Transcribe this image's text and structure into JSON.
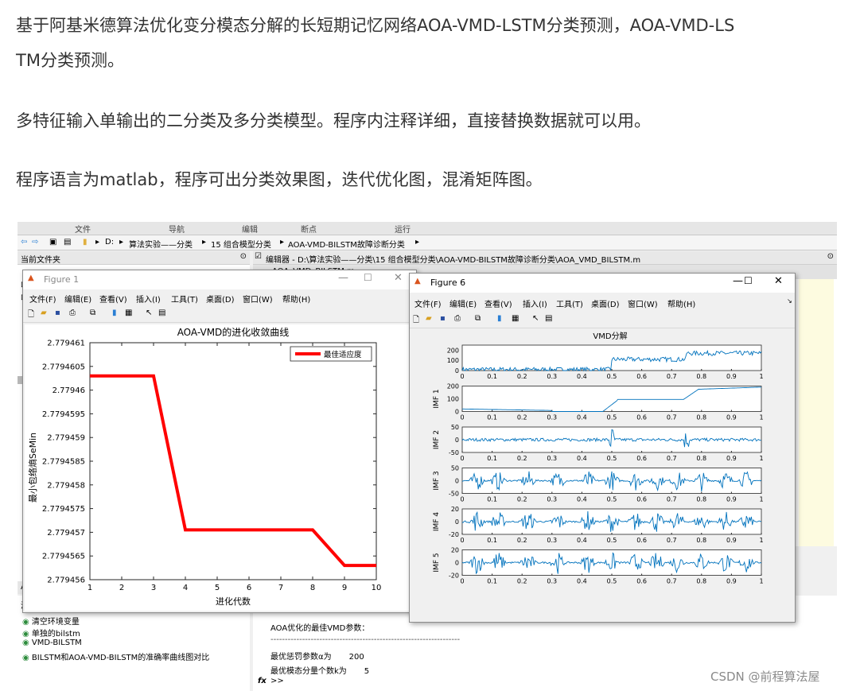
{
  "article": {
    "line1": "基于阿基米德算法优化变分模态分解的长短期记忆网络AOA-VMD-LSTM分类预测，AOA-VMD-LS",
    "line2": "TM分类预测。",
    "line3": "多特征输入单输出的二分类及多分类模型。程序内注释详细，直接替换数据就可以用。",
    "line4": "程序语言为matlab，程序可出分类效果图，迭代优化图，混淆矩阵图。"
  },
  "matlab": {
    "ribbon_tabs": [
      "文件",
      "导航",
      "编辑",
      "断点",
      "运行"
    ],
    "address": [
      "D:",
      "算法实验——分类",
      "15 组合模型分类",
      "AOA-VMD-BILSTM故障诊断分类"
    ],
    "current_folder_title": "当前文件夹",
    "editor_title": "编辑器 - D:\\算法实验——分类\\15 组合模型分类\\AOA-VMD-BILSTM故障诊断分类\\AOA_VMD_BILSTM.m",
    "editor_tab": "AOA_VMD_BILSTM.m",
    "history_items": [
      "清空环境变量",
      "单独的bilstm",
      "VMD-BILSTM",
      "BILSTM和AOA-VMD-BILSTM的准确率曲线图对比"
    ],
    "history_title": "清",
    "history_tab": "AO",
    "console": {
      "line1": "AOA优化的最佳VMD参数：",
      "divider": "------------------------------------------------------------------",
      "line3_label": "最优惩罚参数α为",
      "line3_value": "200",
      "line4_label": "最优模态分量个数k为",
      "line4_value": "5",
      "prompt": ">>",
      "fx": "fx"
    }
  },
  "figure1": {
    "title": "Figure 1",
    "menu": [
      "文件(F)",
      "编辑(E)",
      "查看(V)",
      "插入(I)",
      "工具(T)",
      "桌面(D)",
      "窗口(W)",
      "帮助(H)"
    ],
    "chart_data": {
      "type": "line",
      "title": "AOA-VMD的进化收敛曲线",
      "xlabel": "进化代数",
      "ylabel": "最小包络熵SeMin",
      "xlim": [
        1,
        10
      ],
      "ylim": [
        2.779456,
        2.779461
      ],
      "xticks": [
        "1",
        "2",
        "3",
        "4",
        "5",
        "6",
        "7",
        "8",
        "9",
        "10"
      ],
      "yticks": [
        "2.779461",
        "2.7794605",
        "2.77946",
        "2.7794595",
        "2.779459",
        "2.7794585",
        "2.779458",
        "2.7794575",
        "2.779457",
        "2.7794565",
        "2.779456"
      ],
      "series": [
        {
          "name": "最佳适应度",
          "x": [
            1,
            2,
            3,
            4,
            5,
            6,
            7,
            8,
            9,
            10
          ],
          "y": [
            2.7794603,
            2.7794603,
            2.7794603,
            2.77945705,
            2.77945705,
            2.77945705,
            2.77945705,
            2.77945705,
            2.7794563,
            2.7794563
          ],
          "color": "#ff0000"
        }
      ],
      "legend": "top-right"
    }
  },
  "figure6": {
    "title": "Figure 6",
    "menu": [
      "文件(F)",
      "编辑(E)",
      "查看(V)",
      "插入(I)",
      "工具(T)",
      "桌面(D)",
      "窗口(W)",
      "帮助(H)"
    ],
    "chart_data": {
      "type": "line",
      "title": "VMD分解",
      "xlim": [
        0,
        1
      ],
      "xticks": [
        "0",
        "0.1",
        "0.2",
        "0.3",
        "0.4",
        "0.5",
        "0.6",
        "0.7",
        "0.8",
        "0.9",
        "1"
      ],
      "subplots": [
        {
          "ylabel": "",
          "yticks": [
            "200",
            "100",
            "0"
          ],
          "ylim": [
            0,
            250
          ]
        },
        {
          "ylabel": "IMF 1",
          "yticks": [
            "200",
            "100",
            "0"
          ],
          "ylim": [
            0,
            200
          ]
        },
        {
          "ylabel": "IMF 2",
          "yticks": [
            "50",
            "0",
            "-50"
          ],
          "ylim": [
            -50,
            50
          ]
        },
        {
          "ylabel": "IMF 3",
          "yticks": [
            "50",
            "0",
            "-50"
          ],
          "ylim": [
            -50,
            50
          ]
        },
        {
          "ylabel": "IMF 4",
          "yticks": [
            "20",
            "0",
            "-20"
          ],
          "ylim": [
            -20,
            20
          ]
        },
        {
          "ylabel": "IMF 5",
          "yticks": [
            "20",
            "0",
            "-20"
          ],
          "ylim": [
            -20,
            20
          ]
        }
      ],
      "color": "#0072bd"
    }
  },
  "watermark": "CSDN @前程算法屋"
}
